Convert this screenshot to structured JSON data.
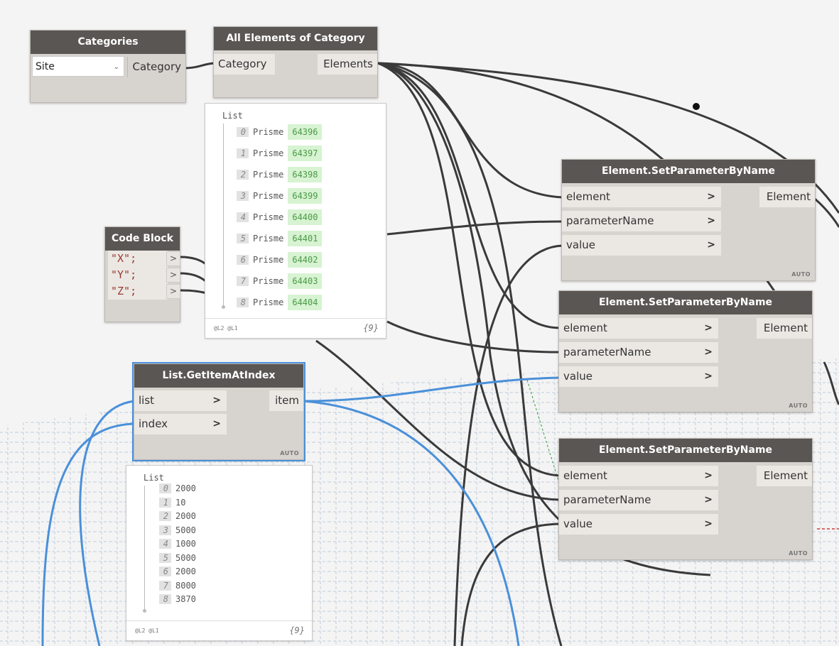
{
  "nodes": {
    "categories": {
      "title": "Categories",
      "dropdown_value": "Site",
      "dropdown_caret": "⌄",
      "output": "Category"
    },
    "all_elements": {
      "title": "All Elements of Category",
      "input": "Category",
      "output": "Elements"
    },
    "code_block": {
      "title": "Code Block",
      "lines": [
        "\"X\";",
        "\"Y\";",
        "\"Z\";"
      ],
      "out": ">"
    },
    "get_item": {
      "title": "List.GetItemAtIndex",
      "inputs": [
        "list",
        "index"
      ],
      "output": "item",
      "lacing": "AUTO",
      "chevron": ">"
    },
    "set_param_1": {
      "title": "Element.SetParameterByName",
      "inputs": [
        "element",
        "parameterName",
        "value"
      ],
      "output": "Element",
      "lacing": "AUTO",
      "chevron": ">"
    },
    "set_param_2": {
      "title": "Element.SetParameterByName",
      "inputs": [
        "element",
        "parameterName",
        "value"
      ],
      "output": "Element",
      "lacing": "AUTO",
      "chevron": ">"
    },
    "set_param_3": {
      "title": "Element.SetParameterByName",
      "inputs": [
        "element",
        "parameterName",
        "value"
      ],
      "output": "Element",
      "lacing": "AUTO",
      "chevron": ">"
    }
  },
  "preview_elements": {
    "title": "List",
    "items": [
      {
        "index": "0",
        "name": "Prisme",
        "id": "64396"
      },
      {
        "index": "1",
        "name": "Prisme",
        "id": "64397"
      },
      {
        "index": "2",
        "name": "Prisme",
        "id": "64398"
      },
      {
        "index": "3",
        "name": "Prisme",
        "id": "64399"
      },
      {
        "index": "4",
        "name": "Prisme",
        "id": "64400"
      },
      {
        "index": "5",
        "name": "Prisme",
        "id": "64401"
      },
      {
        "index": "6",
        "name": "Prisme",
        "id": "64402"
      },
      {
        "index": "7",
        "name": "Prisme",
        "id": "64403"
      },
      {
        "index": "8",
        "name": "Prisme",
        "id": "64404"
      }
    ],
    "levels": "@L2 @L1",
    "count": "{9}"
  },
  "preview_values": {
    "title": "List",
    "items": [
      {
        "index": "0",
        "value": "2000"
      },
      {
        "index": "1",
        "value": "10"
      },
      {
        "index": "2",
        "value": "2000"
      },
      {
        "index": "3",
        "value": "5000"
      },
      {
        "index": "4",
        "value": "1000"
      },
      {
        "index": "5",
        "value": "5000"
      },
      {
        "index": "6",
        "value": "2000"
      },
      {
        "index": "7",
        "value": "8000"
      },
      {
        "index": "8",
        "value": "3870"
      }
    ],
    "levels": "@L2 @L1",
    "count": "{9}"
  },
  "colors": {
    "wire_dark": "#3a3a3a",
    "wire_selected": "#4a90d9",
    "node_header": "#5a5653",
    "node_body": "#d7d3cf",
    "preview_id_bg": "#d7f3d2"
  }
}
